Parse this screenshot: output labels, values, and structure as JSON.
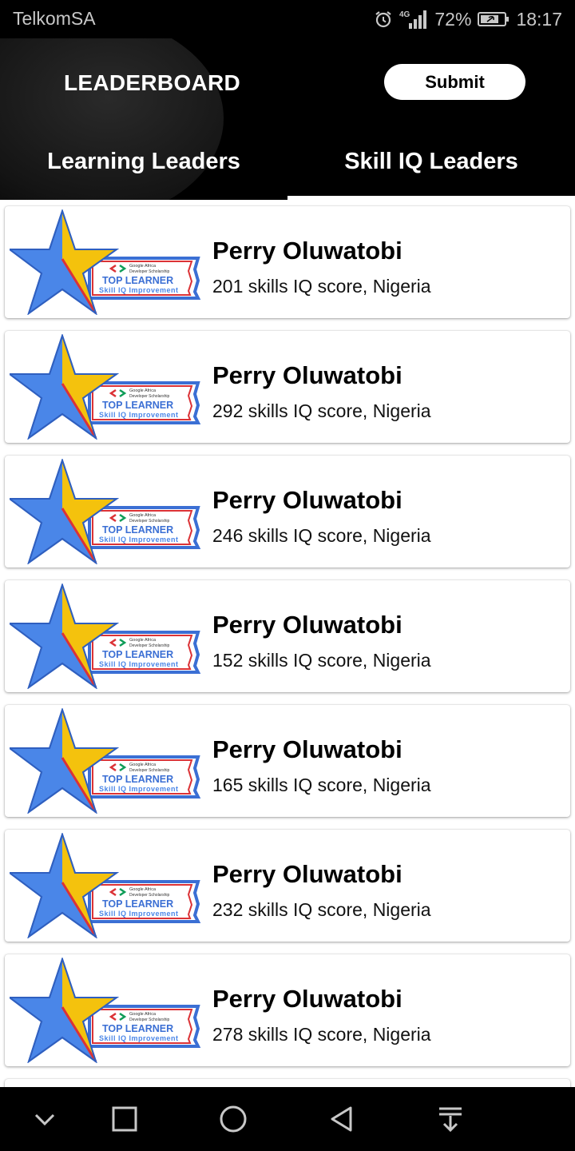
{
  "status_bar": {
    "carrier": "TelkomSA",
    "network": "4G",
    "battery_percent": "72%",
    "time": "18:17"
  },
  "header": {
    "title": "LEADERBOARD",
    "submit_label": "Submit"
  },
  "tabs": [
    {
      "label": "Learning Leaders",
      "selected": false
    },
    {
      "label": "Skill IQ Leaders",
      "selected": true
    }
  ],
  "badge": {
    "line1": "Google Africa",
    "line2": "Developer Scholarship",
    "line3": "TOP LEARNER",
    "line4": "Skill IQ Improvement"
  },
  "leaders": [
    {
      "name": "Perry Oluwatobi",
      "score": "201",
      "suffix": "skills IQ score,",
      "country": "Nigeria"
    },
    {
      "name": "Perry Oluwatobi",
      "score": "292",
      "suffix": "skills IQ score,",
      "country": "Nigeria"
    },
    {
      "name": "Perry Oluwatobi",
      "score": "246",
      "suffix": "skills IQ score,",
      "country": "Nigeria"
    },
    {
      "name": "Perry Oluwatobi",
      "score": "152",
      "suffix": "skills IQ score,",
      "country": "Nigeria"
    },
    {
      "name": "Perry Oluwatobi",
      "score": "165",
      "suffix": "skills IQ score,",
      "country": "Nigeria"
    },
    {
      "name": "Perry Oluwatobi",
      "score": "232",
      "suffix": "skills IQ score,",
      "country": "Nigeria"
    },
    {
      "name": "Perry Oluwatobi",
      "score": "278",
      "suffix": "skills IQ score,",
      "country": "Nigeria"
    }
  ],
  "colors": {
    "star_blue": "#4a86e8",
    "star_yellow": "#f4c20d",
    "ribbon_red": "#db3236",
    "ribbon_blue": "#3b6fd4"
  }
}
